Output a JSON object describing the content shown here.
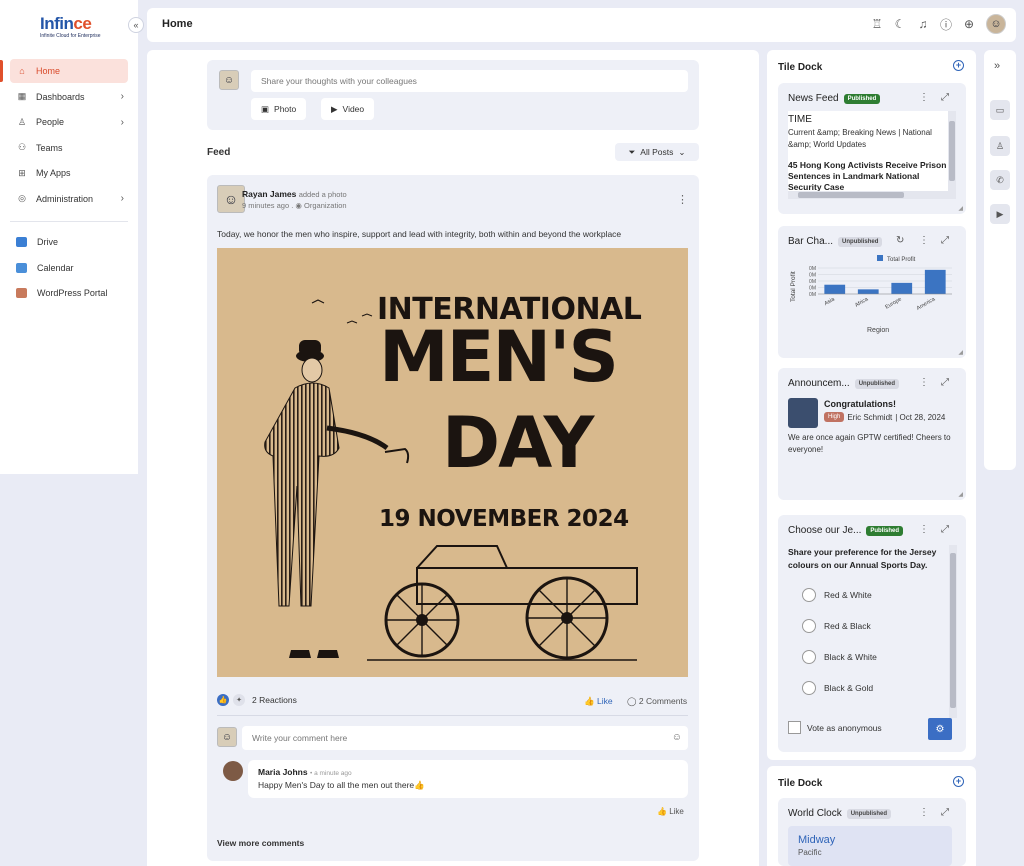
{
  "brand": {
    "logo_main": "Infin",
    "logo_accent": "ce",
    "logo_sub": "Infinite Cloud for Enterprise"
  },
  "sidebar": {
    "collapse_icon": "«",
    "items": [
      {
        "label": "Home",
        "icon": "home-icon"
      },
      {
        "label": "Dashboards",
        "icon": "dashboard-icon"
      },
      {
        "label": "People",
        "icon": "person-icon"
      },
      {
        "label": "Teams",
        "icon": "teams-icon"
      },
      {
        "label": "My Apps",
        "icon": "apps-icon"
      },
      {
        "label": "Administration",
        "icon": "admin-icon"
      }
    ],
    "apps": [
      {
        "label": "Drive",
        "color": "#3b7fd4"
      },
      {
        "label": "Calendar",
        "color": "#4a8fd9"
      },
      {
        "label": "WordPress Portal",
        "color": "#c87a5c"
      }
    ]
  },
  "topbar": {
    "title": "Home"
  },
  "composer": {
    "placeholder": "Share your thoughts with your colleagues",
    "photo_label": "Photo",
    "video_label": "Video"
  },
  "feed": {
    "label": "Feed",
    "filter_label": "All Posts"
  },
  "post": {
    "author": "Rayan James",
    "action": "added a photo",
    "time": "9 minutes ago",
    "audience": "Organization",
    "text": "Today, we honor the men who inspire, support and lead with integrity, both within and beyond the workplace",
    "poster": {
      "line1": "INTERNATIONAL",
      "line2": "MEN'S",
      "line3": "DAY",
      "line4": "19 NOVEMBER 2024"
    },
    "reactions_label": "2 Reactions",
    "like_label": "Like",
    "comments_label": "2 Comments",
    "comment_placeholder": "Write your comment here",
    "comment": {
      "author": "Maria Johns",
      "time": "• a minute ago",
      "text": "Happy Men's Day to all the men out there👍",
      "like_label": "Like"
    },
    "view_more": "View more comments"
  },
  "dock": {
    "title": "Tile Dock",
    "news": {
      "title": "News Feed",
      "badge": "Published",
      "source": "TIME",
      "desc": "Current &amp; Breaking News | National &amp; World Updates",
      "headline": "45 Hong Kong Activists Receive Prison Sentences in Landmark National Security Case"
    },
    "chart_tile": {
      "title": "Bar Cha...",
      "badge": "Unpublished"
    },
    "announcement": {
      "title": "Announcem...",
      "badge": "Unpublished",
      "heading": "Congratulations!",
      "priority": "High",
      "author": "Eric Schmidt",
      "date": "| Oct 28, 2024",
      "text": "We are once again GPTW certified! Cheers to everyone!"
    },
    "poll": {
      "title": "Choose our Je...",
      "badge": "Published",
      "question": "Share your preference for the Jersey colours on our Annual Sports Day.",
      "options": [
        "Red & White",
        "Red & Black",
        "Black & White",
        "Black & Gold"
      ],
      "anonymous_label": "Vote as anonymous"
    }
  },
  "dock2": {
    "title": "Tile Dock",
    "clock": {
      "title": "World Clock",
      "badge": "Unpublished",
      "city": "Midway",
      "zone": "Pacific"
    }
  },
  "chart_data": {
    "type": "bar",
    "categories": [
      "Asia",
      "Africa",
      "Europe",
      "America"
    ],
    "series": [
      {
        "name": "Total Profit",
        "values": [
          1,
          0.5,
          1.2,
          2.6
        ]
      }
    ],
    "title": "",
    "xlabel": "Region",
    "ylabel": "Total Profit",
    "ylim": [
      0,
      2.8
    ],
    "yticks": [
      "0M",
      "0M",
      "0M",
      "0M",
      "0M"
    ],
    "bar_color": "#3b74c2",
    "legend": "top"
  }
}
